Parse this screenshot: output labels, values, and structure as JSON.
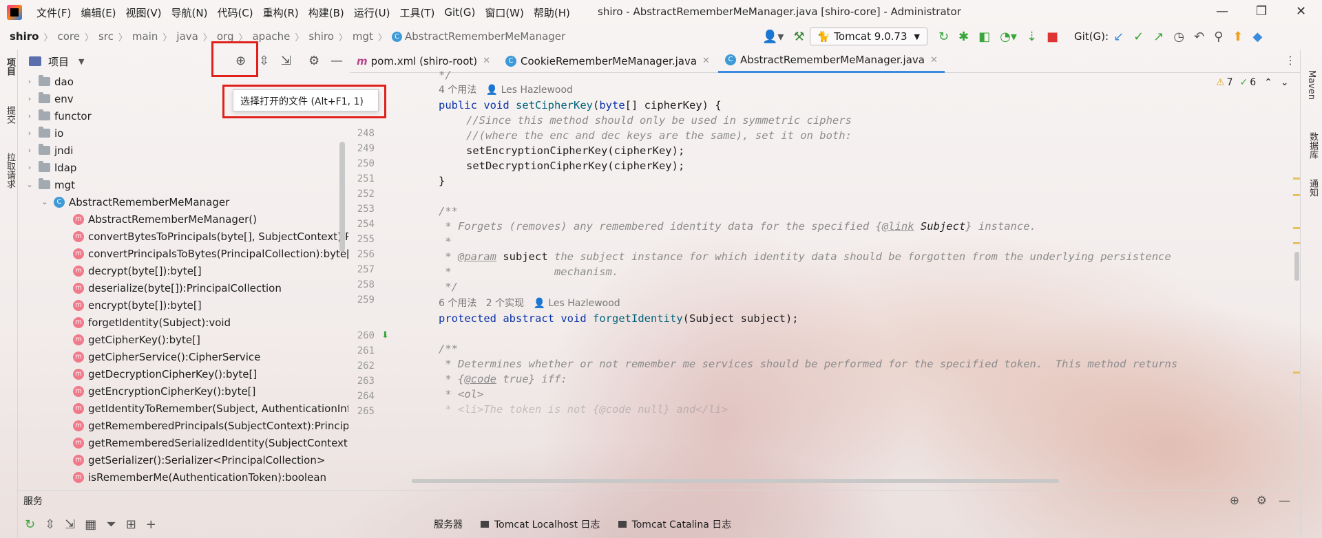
{
  "app_title": "shiro - AbstractRememberMeManager.java [shiro-core] - Administrator",
  "menu": [
    "文件(F)",
    "编辑(E)",
    "视图(V)",
    "导航(N)",
    "代码(C)",
    "重构(R)",
    "构建(B)",
    "运行(U)",
    "工具(T)",
    "Git(G)",
    "窗口(W)",
    "帮助(H)"
  ],
  "breadcrumb": [
    "shiro",
    "core",
    "src",
    "main",
    "java",
    "org",
    "apache",
    "shiro",
    "mgt",
    "AbstractRememberMeManager"
  ],
  "run_config": "Tomcat 9.0.73",
  "git_label": "Git(G):",
  "left_stripe": {
    "project": "项目",
    "commit": "提交",
    "pull": "拉取请求"
  },
  "right_stripe": {
    "maven": "Maven",
    "database": "数据库",
    "notify": "通知"
  },
  "project_panel": {
    "title": "项目"
  },
  "tooltip": "选择打开的文件 (Alt+F1, 1)",
  "tree": {
    "folders": [
      "dao",
      "env",
      "functor",
      "io",
      "jndi",
      "ldap",
      "mgt"
    ],
    "class_name": "AbstractRememberMeManager",
    "methods": [
      "AbstractRememberMeManager()",
      "convertBytesToPrincipals(byte[], SubjectContext):Pri",
      "convertPrincipalsToBytes(PrincipalCollection):byte[]",
      "decrypt(byte[]):byte[]",
      "deserialize(byte[]):PrincipalCollection",
      "encrypt(byte[]):byte[]",
      "forgetIdentity(Subject):void",
      "getCipherKey():byte[]",
      "getCipherService():CipherService",
      "getDecryptionCipherKey():byte[]",
      "getEncryptionCipherKey():byte[]",
      "getIdentityToRemember(Subject, AuthenticationInfo",
      "getRememberedPrincipals(SubjectContext):Principa",
      "getRememberedSerializedIdentity(SubjectContext):l",
      "getSerializer():Serializer<PrincipalCollection>",
      "isRememberMe(AuthenticationToken):boolean"
    ]
  },
  "tabs": [
    {
      "label": "pom.xml (shiro-root)",
      "icon": "m"
    },
    {
      "label": "CookieRememberMeManager.java",
      "icon": "c"
    },
    {
      "label": "AbstractRememberMeManager.java",
      "icon": "c"
    }
  ],
  "inspections": {
    "warnings": "7",
    "weak": "6"
  },
  "hints": {
    "h1": "4 个用法",
    "h1_author": "Les Hazlewood",
    "h2": "6 个用法",
    "h2_impl": "2 个实现",
    "h2_author": "Les Hazlewood"
  },
  "line_numbers": [
    "248",
    "249",
    "250",
    "251",
    "252",
    "253",
    "254",
    "255",
    "256",
    "257",
    "258",
    "259",
    "260",
    "261",
    "262",
    "263",
    "264",
    "265"
  ],
  "code": {
    "top_partial": "*/",
    "l247_kw1": "public",
    "l247_kw2": "void",
    "l247_fn": "setCipherKey",
    "l247_kw3": "byte",
    "l247_rest": "[] cipherKey) {",
    "l248": "//Since this method should only be used in symmetric ciphers",
    "l249": "//(where the enc and dec keys are the same), set it on both:",
    "l250": "setEncryptionCipherKey(cipherKey);",
    "l251": "setDecryptionCipherKey(cipherKey);",
    "l252": "}",
    "l254": "/**",
    "l255a": " * Forgets (removes) any remembered identity data for the specified {",
    "l255tag": "@link",
    "l255ref": " Subject",
    "l255b": "} instance.",
    "l256": " *",
    "l257a": " * ",
    "l257tag": "@param",
    "l257ref": " subject",
    "l257b": " the subject instance for which identity data should be forgotten from the underlying persistence",
    "l258": " *                mechanism.",
    "l259": " */",
    "l260_kw1": "protected",
    "l260_kw2": "abstract",
    "l260_kw3": "void",
    "l260_fn": "forgetIdentity",
    "l260_rest": "(Subject subject);",
    "l262": "/**",
    "l263": " * Determines whether or not remember me services should be performed for the specified token.  This method returns",
    "l264a": " * {",
    "l264tag": "@code",
    "l264b": " true} iff:",
    "l265": " * <ol>",
    "l266": " * <li>The token is not {@code null} and</li>"
  },
  "services": {
    "title": "服务",
    "tabs": [
      "服务器",
      "Tomcat Localhost 日志",
      "Tomcat Catalina 日志"
    ]
  }
}
